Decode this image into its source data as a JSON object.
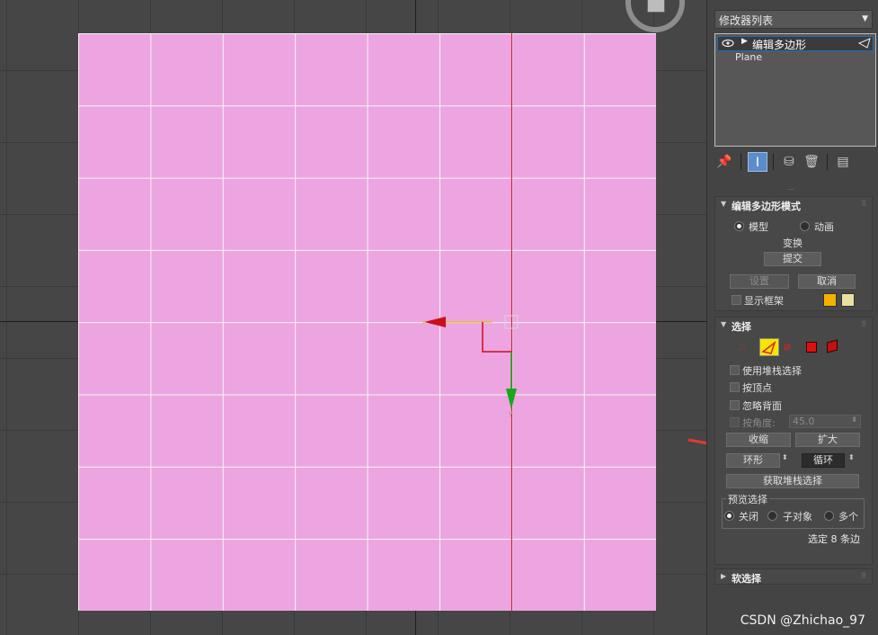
{
  "modifier_list": {
    "label": "修改器列表"
  },
  "stack": {
    "items": [
      {
        "label": "编辑多边形",
        "selected": true
      },
      {
        "label": "Plane",
        "selected": false
      }
    ]
  },
  "stack_toolbar": {
    "icons": [
      "pin-stack-icon",
      "show-end-result-icon",
      "make-unique-icon",
      "remove-modifier-icon",
      "configure-modifier-sets-icon"
    ]
  },
  "edit_poly_mode": {
    "title": "编辑多边形模式",
    "radio_model": "模型",
    "radio_animate": "动画",
    "transform_label": "变换",
    "commit_button": "提交",
    "setup_button": "设置",
    "cancel_button": "取消",
    "show_cage": "显示框架",
    "cage_colors": [
      "#f5b100",
      "#e8e0a0"
    ]
  },
  "selection": {
    "title": "选择",
    "subobject_icons": [
      "vertex-icon",
      "edge-icon",
      "border-icon",
      "polygon-icon",
      "element-icon"
    ],
    "use_stack_selection": "使用堆栈选择",
    "by_vertex": "按顶点",
    "ignore_backfacing": "忽略背面",
    "by_angle": "按角度:",
    "by_angle_value": "45.0",
    "shrink_button": "收缩",
    "grow_button": "扩大",
    "ring_button": "环形",
    "loop_button": "循环",
    "get_stack_selection_button": "获取堆栈选择",
    "preview_group": "预览选择",
    "preview_off": "关闭",
    "preview_subobject": "子对象",
    "preview_multi": "多个",
    "selected_info": "选定 8 条边"
  },
  "soft_selection": {
    "title": "软选择"
  },
  "watermark": "CSDN @Zhichao_97",
  "colors": {
    "plane": "#eca5e0",
    "accent_red": "#e0141e",
    "gizmo_green": "#18a818",
    "active_blue": "#5b8ccc"
  }
}
